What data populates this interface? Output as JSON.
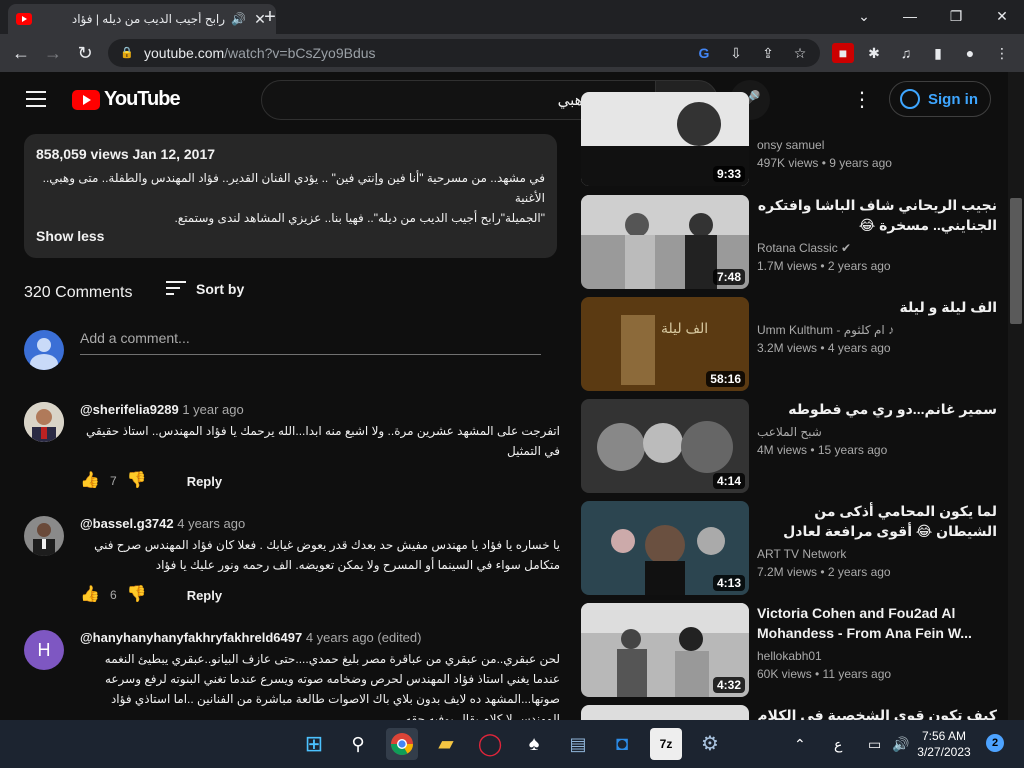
{
  "browser": {
    "tab_title": "رابح أجيب الديب من ديله | فؤاد",
    "url_host": "youtube.com",
    "url_path": "/watch?v=bCsZyo9Bdus"
  },
  "header": {
    "logo_text": "YouTube",
    "search_value": "متى وهبي",
    "signin_label": "Sign in"
  },
  "description": {
    "meta": "858,059 views  Jan 12, 2017",
    "line1": "في مشهد.. من مسرحية \"أنا فين وإنتي فين\" .. يؤدي الفنان القدير.. فؤاد المهندس والطفلة.. متى وهبي.. الأغنية",
    "line2": "\"الجميلة\"رابح أجيب الديب من ديله\".. فهيا بنا.. عزيزي المشاهد لندى وستمتع.",
    "show_less": "Show less"
  },
  "comments": {
    "count_label": "320 Comments",
    "sort_label": "Sort by",
    "add_placeholder": "Add a comment...",
    "items": [
      {
        "author": "@sherifelia9289",
        "time": "1 year ago",
        "text": "اتفرجت على المشهد عشرين مرة.. ولا اشبع منه ابدا...الله يرحمك يا فؤاد المهندس.. استاذ حقيقي في التمثيل",
        "likes": "7",
        "reply": "Reply"
      },
      {
        "author": "@bassel.g3742",
        "time": "4 years ago",
        "text": "يا خساره يا فؤاد يا مهندس مفيش حد بعدك قدر يعوض غيابك . فعلا كان فؤاد المهندس صرح فني متكامل سواء في السينما أو المسرح ولا يمكن تعويضه. الف رحمه ونور عليك يا فؤاد",
        "likes": "6",
        "reply": "Reply"
      },
      {
        "author": "@hanyhanyhanyfakhryfakhreld6497",
        "time": "4 years ago (edited)",
        "text": "لحن عبقري..من عبقري من عباقرة مصر بليغ حمدي....حتى عازف البيانو..عبقري يبطيئ النغمه عندما يغني استاذ فؤاد المهندس لحرص وضخامه صوته ويسرع عندما تغني البنوته لرفع وسرعه صوتها...المشهد ده لايف بدون بلاي باك الاصوات طالعة مباشرة من الفنانين ..اما استاذي فؤاد المهندس لا كلام يقال يوفيه حقه"
      }
    ]
  },
  "sidebar": {
    "videos": [
      {
        "title": "",
        "channel": "onsy samuel",
        "meta": "497K views • 9 years ago",
        "duration": "9:33",
        "rtl": false
      },
      {
        "title": "نجيب الريحاني شاف الباشا وافتكره الجنايني.. مسخرة 😂",
        "channel": "Rotana Classic",
        "verified": true,
        "meta": "1.7M views • 2 years ago",
        "duration": "7:48",
        "rtl": true
      },
      {
        "title": "الف ليلة و ليلة",
        "channel": "Umm Kulthum - ام كلثوم",
        "music": true,
        "meta": "3.2M views • 4 years ago",
        "duration": "58:16",
        "rtl": true
      },
      {
        "title": "سمير غانم...دو ري مي فطوطه",
        "channel": "شبح الملاعب",
        "meta": "4M views • 15 years ago",
        "duration": "4:14",
        "rtl": true
      },
      {
        "title": "لما يكون المحامي أذكى من الشيطان 😂 أقوى مرافعة لعادل أمام",
        "channel": "ART TV Network",
        "meta": "7.2M views • 2 years ago",
        "duration": "4:13",
        "rtl": true
      },
      {
        "title": "Victoria Cohen and Fou2ad Al Mohandess - From Ana Fein W...",
        "channel": "hellokabh01",
        "meta": "60K views • 11 years ago",
        "duration": "4:32",
        "rtl": false
      },
      {
        "title": "كيف تكون قوي الشخصية في الكلام الدكتور",
        "channel": "",
        "meta": "",
        "duration": "",
        "rtl": true
      }
    ]
  },
  "taskbar": {
    "lang": "ع",
    "time": "7:56 AM",
    "date": "3/27/2023",
    "notif_count": "2"
  }
}
